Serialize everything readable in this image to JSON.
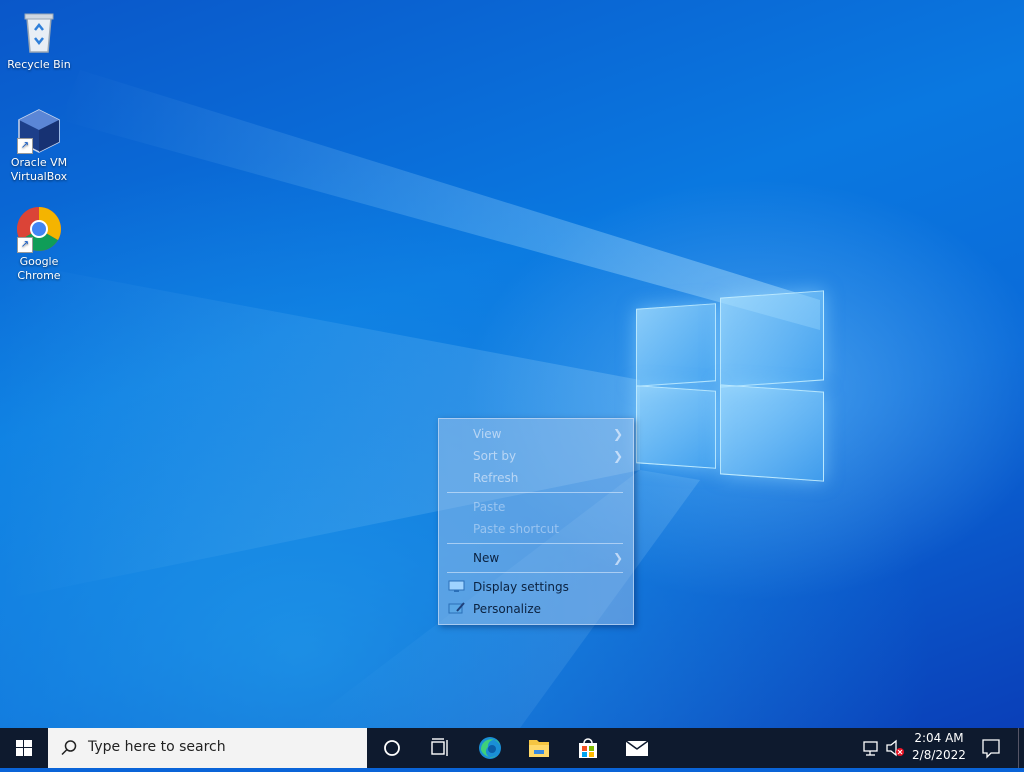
{
  "desktop": {
    "icons": [
      {
        "label": "Recycle Bin",
        "icon": "recycle-bin-icon"
      },
      {
        "label": "Oracle VM VirtualBox",
        "line1": "Oracle VM",
        "line2": "VirtualBox",
        "icon": "virtualbox-icon"
      },
      {
        "label": "Google Chrome",
        "line1": "Google",
        "line2": "Chrome",
        "icon": "chrome-icon"
      }
    ]
  },
  "context_menu": {
    "items": [
      {
        "label": "View",
        "state": "dim",
        "submenu": true
      },
      {
        "label": "Sort by",
        "state": "dim",
        "submenu": true
      },
      {
        "label": "Refresh",
        "state": "dim"
      },
      {
        "label": "Paste",
        "state": "disabled"
      },
      {
        "label": "Paste shortcut",
        "state": "disabled"
      },
      {
        "label": "New",
        "state": "enabled",
        "submenu": true
      },
      {
        "label": "Display settings",
        "state": "enabled",
        "icon": "display-settings-icon"
      },
      {
        "label": "Personalize",
        "state": "enabled",
        "icon": "personalize-icon"
      }
    ]
  },
  "taskbar": {
    "search_placeholder": "Type here to search",
    "pinned": [
      "task-view-icon",
      "edge-icon",
      "file-explorer-icon",
      "store-icon",
      "mail-icon"
    ],
    "clock": {
      "time": "2:04 AM",
      "date": "2/8/2022"
    }
  },
  "colors": {
    "taskbar": "#0e1a2e",
    "accent": "#0078d7"
  }
}
